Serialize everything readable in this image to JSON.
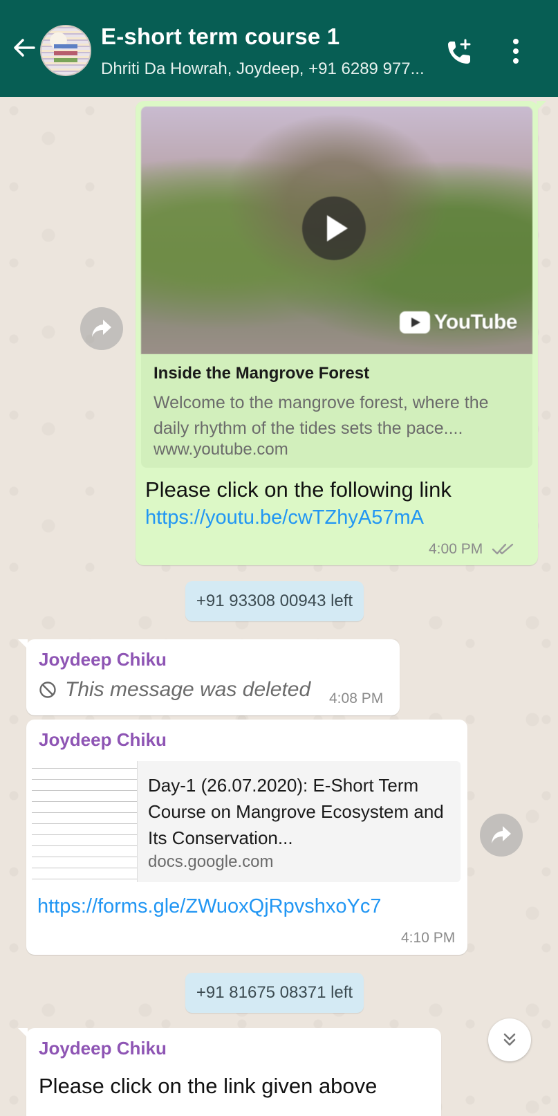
{
  "header": {
    "title": "E-short term course 1",
    "subtitle": "Dhriti Da Howrah, Joydeep, +91 6289 977...",
    "icons": [
      "back-arrow-icon",
      "group-avatar",
      "add-call-icon",
      "more-options-icon"
    ]
  },
  "messages": {
    "video": {
      "preview_source": "YouTube",
      "preview_title": "Inside the Mangrove Forest",
      "preview_description": "Welcome to the mangrove forest, where the daily rhythm of the tides sets the pace....",
      "preview_domain": "www.youtube.com",
      "text": "Please click on the following link",
      "link": "https://youtu.be/cwTZhyA57mA",
      "time": "4:00 PM"
    },
    "system1": "+91 93308 00943 left",
    "deleted": {
      "sender": "Joydeep Chiku",
      "text": "This message was deleted",
      "time": "4:08 PM"
    },
    "form": {
      "sender": "Joydeep Chiku",
      "preview_title": "Day-1 (26.07.2020): E-Short Term Course on Mangrove Ecosystem and Its Conservation...",
      "preview_domain": "docs.google.com",
      "link": "https://forms.gle/ZWuoxQjRpvshxoYc7",
      "time": "4:10 PM"
    },
    "system2": "+91 81675 08371 left",
    "last": {
      "sender": "Joydeep Chiku",
      "text": "Please click on the link given above"
    }
  },
  "colors": {
    "header": "#075e54",
    "outgoing_bubble": "#dcf8c6",
    "incoming_bubble": "#ffffff",
    "link": "#2196f3",
    "sender_name": "#8e55b4",
    "system_pill": "#d4eaf4"
  }
}
